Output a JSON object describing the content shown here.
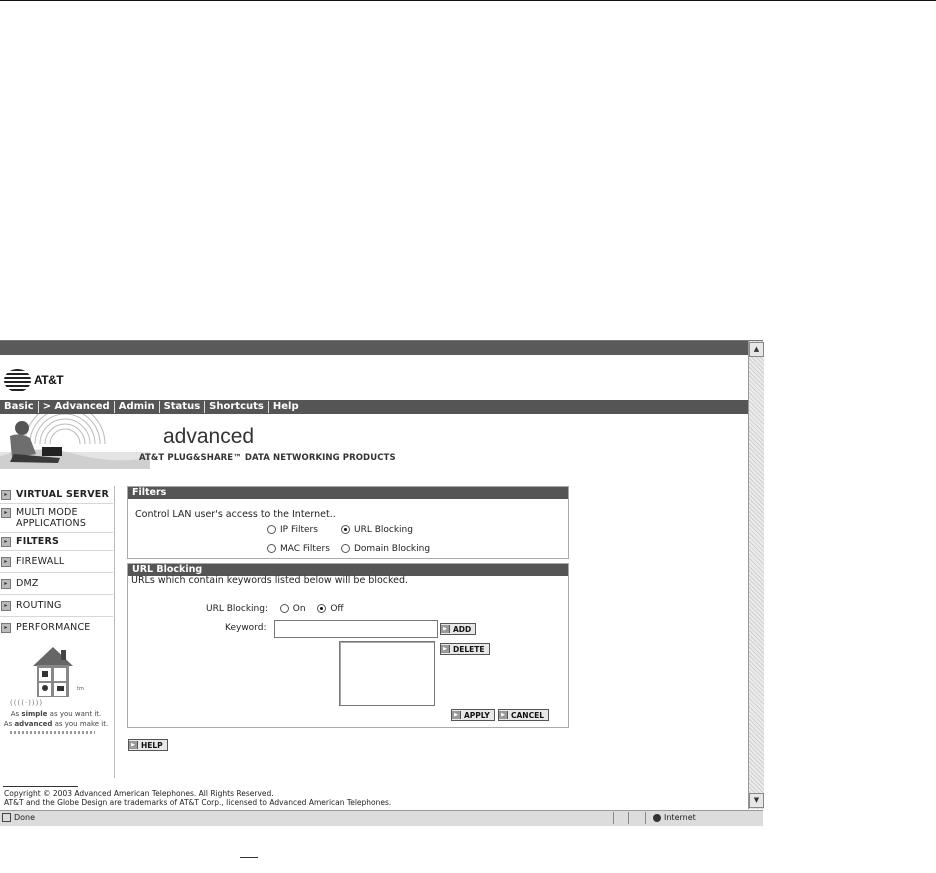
{
  "logo": {
    "text": "AT&T"
  },
  "nav": [
    "Basic",
    "> Advanced",
    "Admin",
    "Status",
    "Shortcuts",
    "Help"
  ],
  "banner": {
    "title": "advanced",
    "subtitle": "AT&T PLUG&SHARE™ DATA NETWORKING PRODUCTS"
  },
  "sidebar": {
    "items": [
      {
        "label": "VIRTUAL SERVER",
        "active": true
      },
      {
        "label": "MULTI MODE APPLICATIONS",
        "active": false
      },
      {
        "label": "FILTERS",
        "active": true
      },
      {
        "label": "FIREWALL",
        "active": false
      },
      {
        "label": "DMZ",
        "active": false
      },
      {
        "label": "ROUTING",
        "active": false
      },
      {
        "label": "PERFORMANCE",
        "active": false
      }
    ],
    "tag_line1_pre": "As ",
    "tag_line1_bold": "simple",
    "tag_line1_post": " as you want it.",
    "tag_line2_pre": "As ",
    "tag_line2_bold": "advanced",
    "tag_line2_post": " as you make it.",
    "tm": "tm",
    "wave": "((((·))))"
  },
  "filters": {
    "header": "Filters",
    "description": "Control LAN user's access to the Internet..",
    "options": {
      "ip": "IP Filters",
      "url": "URL Blocking",
      "mac": "MAC Filters",
      "domain": "Domain Blocking"
    },
    "selected": "URL Blocking"
  },
  "url_blocking": {
    "header": "URL Blocking",
    "description": "URLs which contain keywords listed below will be blocked.",
    "label": "URL Blocking:",
    "on": "On",
    "off": "Off",
    "state": "Off",
    "keyword_label": "Keyword:",
    "keyword_value": "",
    "buttons": {
      "add": "ADD",
      "delete": "DELETE",
      "apply": "APPLY",
      "cancel": "CANCEL"
    }
  },
  "help_button": "HELP",
  "footer": {
    "copyright": "Copyright © 2003 Advanced American Telephones. All Rights Reserved.",
    "trademark": "AT&T and the Globe Design are trademarks of AT&T Corp., licensed to Advanced American Telephones."
  },
  "statusbar": {
    "status": "Done",
    "zone": "Internet"
  }
}
